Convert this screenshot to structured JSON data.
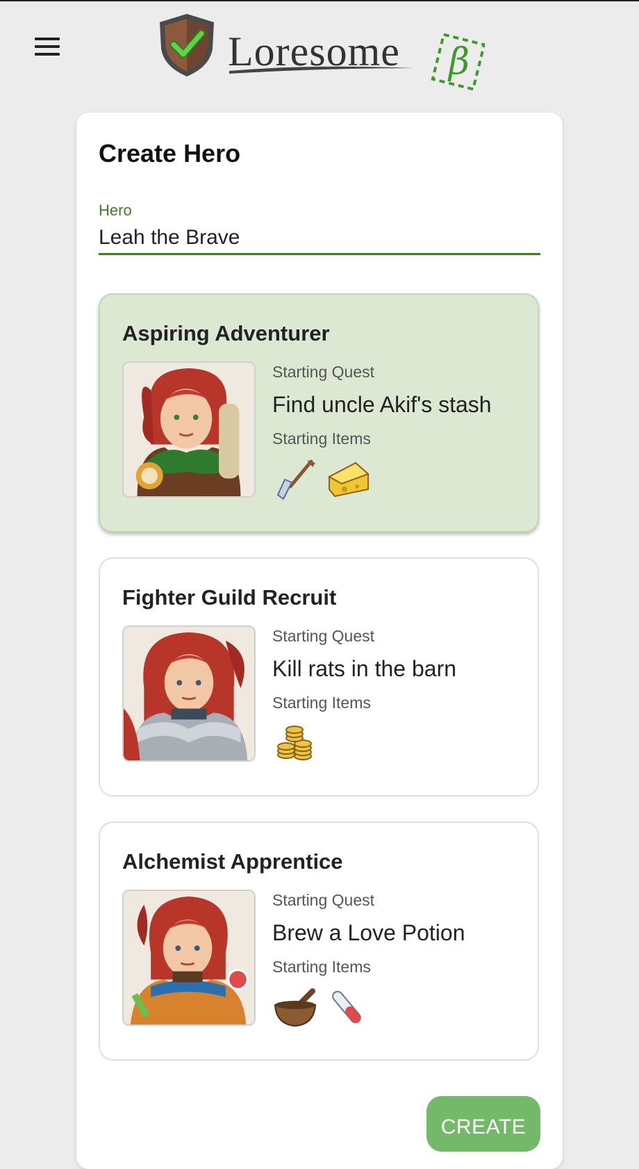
{
  "app": {
    "logo_text": "Loresome",
    "beta_mark": "β"
  },
  "header": {
    "menu_icon": "hamburger-menu-icon"
  },
  "form": {
    "title": "Create Hero",
    "hero_label": "Hero",
    "hero_value": "Leah the Brave"
  },
  "paths": [
    {
      "title": "Aspiring Adventurer",
      "selected": true,
      "quest_label": "Starting Quest",
      "quest": "Find uncle Akif's stash",
      "items_label": "Starting Items",
      "items": [
        "shovel-icon",
        "cheese-icon"
      ]
    },
    {
      "title": "Fighter Guild Recruit",
      "selected": false,
      "quest_label": "Starting Quest",
      "quest": "Kill rats in the barn",
      "items_label": "Starting Items",
      "items": [
        "gold-coins-icon"
      ]
    },
    {
      "title": "Alchemist Apprentice",
      "selected": false,
      "quest_label": "Starting Quest",
      "quest": "Brew a Love Potion",
      "items_label": "Starting Items",
      "items": [
        "mortar-pestle-icon",
        "test-tube-icon"
      ]
    }
  ],
  "actions": {
    "create_label": "CREATE"
  },
  "colors": {
    "accent": "#3d7f24",
    "selected_bg": "#dde8d3",
    "create_bg": "#74b86a"
  }
}
